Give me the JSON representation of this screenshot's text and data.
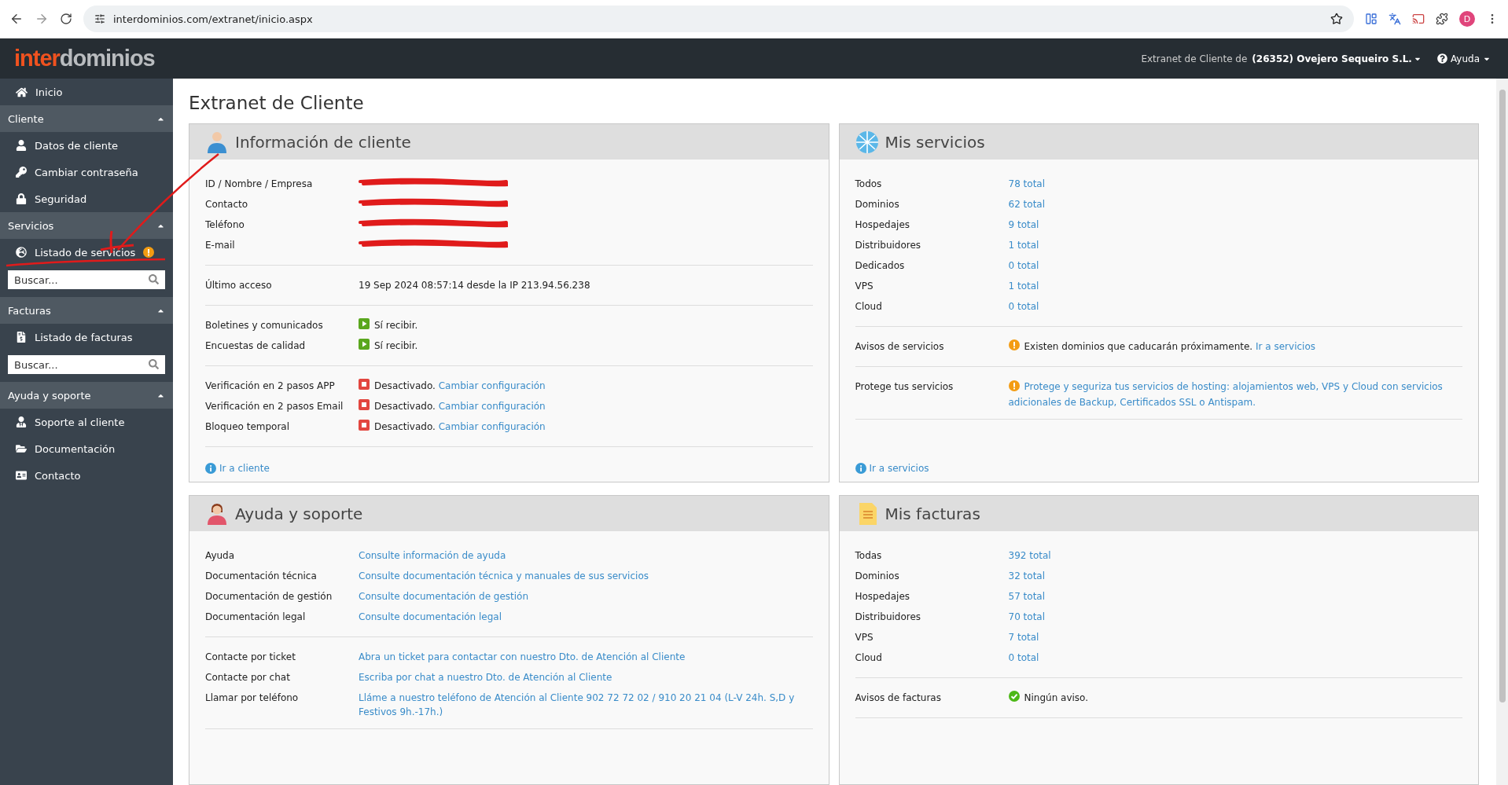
{
  "browser": {
    "url": "interdominios.com/extranet/inicio.aspx",
    "profile_initial": "D"
  },
  "topbar": {
    "logo_first": "inter",
    "logo_second": "dominios",
    "account_prefix": "Extranet de Cliente de",
    "account_name": "(26352) Ovejero Sequeiro S.L.",
    "help": "Ayuda"
  },
  "sidebar": {
    "home": "Inicio",
    "sections": [
      {
        "title": "Cliente",
        "expanded": true,
        "items": [
          {
            "label": "Datos de cliente",
            "alert": false
          },
          {
            "label": "Cambiar contraseña",
            "alert": false
          },
          {
            "label": "Seguridad",
            "alert": false
          }
        ]
      },
      {
        "title": "Servicios",
        "expanded": true,
        "items": [
          {
            "label": "Listado de servicios",
            "alert": true
          }
        ],
        "search": {
          "placeholder": "Buscar..."
        }
      },
      {
        "title": "Facturas",
        "expanded": true,
        "items": [
          {
            "label": "Listado de facturas",
            "alert": false
          }
        ],
        "search": {
          "placeholder": "Buscar..."
        }
      },
      {
        "title": "Ayuda y soporte",
        "expanded": true,
        "items": [
          {
            "label": "Soporte al cliente",
            "alert": false
          },
          {
            "label": "Documentación",
            "alert": false
          },
          {
            "label": "Contacto",
            "alert": false
          }
        ]
      }
    ]
  },
  "page_title": "Extranet de Cliente",
  "panels": [
    {
      "title": "Información de cliente",
      "groups": [
        [
          {
            "kind": "redacted",
            "label": "ID / Nombre / Empresa"
          },
          {
            "kind": "redacted",
            "label": "Contacto"
          },
          {
            "kind": "redacted",
            "label": "Teléfono"
          },
          {
            "kind": "redacted",
            "label": "E-mail"
          }
        ],
        [
          {
            "kind": "text",
            "label": "Último acceso",
            "value": "19 Sep 2024 08:57:14 desde la IP 213.94.56.238"
          }
        ],
        [
          {
            "kind": "on",
            "label": "Boletines y comunicados",
            "value": "Sí recibir."
          },
          {
            "kind": "on",
            "label": "Encuestas de calidad",
            "value": "Sí recibir."
          }
        ],
        [
          {
            "kind": "off",
            "label": "Verificación en 2 pasos APP",
            "value": "Desactivado.",
            "link": "Cambiar configuración"
          },
          {
            "kind": "off",
            "label": "Verificación en 2 pasos Email",
            "value": "Desactivado.",
            "link": "Cambiar configuración"
          },
          {
            "kind": "off",
            "label": "Bloqueo temporal",
            "value": "Desactivado.",
            "link": "Cambiar configuración"
          }
        ]
      ],
      "footer_link": "Ir a cliente"
    },
    {
      "title": "Mis servicios",
      "groups": [
        [
          {
            "kind": "link",
            "label": "Todos",
            "link": "78 total"
          },
          {
            "kind": "link",
            "label": "Dominios",
            "link": "62 total"
          },
          {
            "kind": "link",
            "label": "Hospedajes",
            "link": "9 total"
          },
          {
            "kind": "link",
            "label": "Distribuidores",
            "link": "1 total"
          },
          {
            "kind": "link",
            "label": "Dedicados",
            "link": "0 total"
          },
          {
            "kind": "link",
            "label": "VPS",
            "link": "1 total"
          },
          {
            "kind": "link",
            "label": "Cloud",
            "link": "0 total"
          }
        ],
        [
          {
            "kind": "warning",
            "label": "Avisos de servicios",
            "value": "Existen dominios que caducarán próximamente.",
            "link": "Ir a servicios"
          }
        ],
        [
          {
            "kind": "warning",
            "label": "Protege tus servicios",
            "link": "Protege y seguriza tus servicios de hosting: alojamientos web, VPS y Cloud con servicios adicionales de Backup, Certificados SSL o Antispam."
          }
        ]
      ],
      "footer_link": "Ir a servicios"
    },
    {
      "title": "Ayuda y soporte",
      "groups": [
        [
          {
            "kind": "link",
            "label": "Ayuda",
            "link": "Consulte información de ayuda"
          },
          {
            "kind": "link",
            "label": "Documentación técnica",
            "link": "Consulte documentación técnica y manuales de sus servicios"
          },
          {
            "kind": "link",
            "label": "Documentación de gestión",
            "link": "Consulte documentación de gestión"
          },
          {
            "kind": "link",
            "label": "Documentación legal",
            "link": "Consulte documentación legal"
          }
        ],
        [
          {
            "kind": "link",
            "label": "Contacte por ticket",
            "link": "Abra un ticket para contactar con nuestro Dto. de Atención al Cliente"
          },
          {
            "kind": "link",
            "label": "Contacte por chat",
            "link": "Escriba por chat a nuestro Dto. de Atención al Cliente"
          },
          {
            "kind": "link",
            "label": "Llamar por teléfono",
            "link": "Lláme a nuestro teléfono de Atención al Cliente 902 72 72 02 / 910 20 21 04 (L-V 24h. S,D y Festivos 9h.-17h.)"
          }
        ]
      ]
    },
    {
      "title": "Mis facturas",
      "groups": [
        [
          {
            "kind": "link",
            "label": "Todas",
            "link": "392 total"
          },
          {
            "kind": "link",
            "label": "Dominios",
            "link": "32 total"
          },
          {
            "kind": "link",
            "label": "Hospedajes",
            "link": "57 total"
          },
          {
            "kind": "link",
            "label": "Distribuidores",
            "link": "70 total"
          },
          {
            "kind": "link",
            "label": "VPS",
            "link": "7 total"
          },
          {
            "kind": "link",
            "label": "Cloud",
            "link": "0 total"
          }
        ],
        [
          {
            "kind": "ok",
            "label": "Avisos de facturas",
            "value": "Ningún aviso."
          }
        ]
      ]
    }
  ]
}
